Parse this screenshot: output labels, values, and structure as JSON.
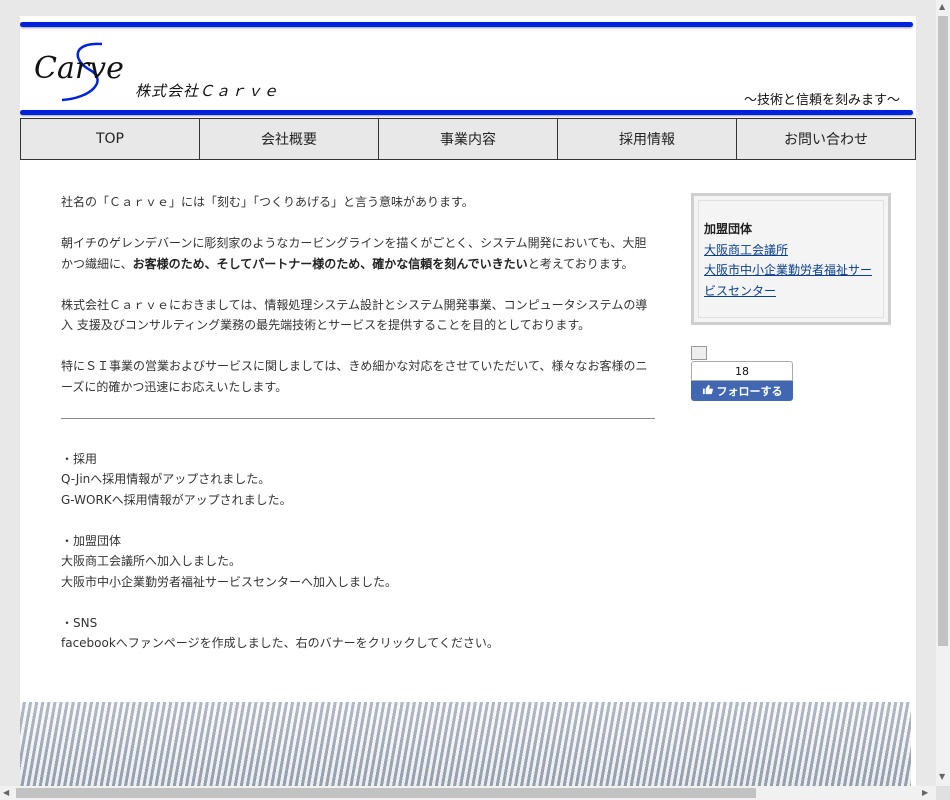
{
  "header": {
    "logo_text": "Carve",
    "company_name": "株式会社Ｃａｒｖｅ",
    "tagline": "～技術と信頼を刻みます～",
    "bar_color": "#0022dd"
  },
  "nav": {
    "items": [
      {
        "label": "TOP"
      },
      {
        "label": "会社概要"
      },
      {
        "label": "事業内容"
      },
      {
        "label": "採用情報"
      },
      {
        "label": "お問い合わせ"
      }
    ]
  },
  "main": {
    "p1": "社名の「Ｃａｒｖｅ」には「刻む」「つくりあげる」と言う意味があります。",
    "p2_a": "朝イチのゲレンデバーンに彫刻家のようなカービングラインを描くがごとく、システム開発においても、大胆かつ繊細に、",
    "p2_bold": "お客様のため、そしてパートナー様のため、確かな信頼を刻んでいきたい",
    "p2_b": "と考えております。",
    "p3": "株式会社Ｃａｒｖｅにおきましては、情報処理システム設計とシステム開発事業、コンピュータシステムの導入 支援及びコンサルティング業務の最先端技術とサービスを提供することを目的としております。",
    "p4": "特にＳＩ事業の営業およびサービスに関しましては、きめ細かな対応をさせていただいて、様々なお客様のニーズに的確かつ迅速にお応えいたします。",
    "news": [
      {
        "heading": "・採用",
        "lines": [
          "Q-Jinへ採用情報がアップされました。",
          "G-WORKへ採用情報がアップされました。"
        ]
      },
      {
        "heading": "・加盟団体",
        "lines": [
          "大阪商工会議所へ加入しました。",
          "大阪市中小企業勤労者福祉サービスセンターへ加入しました。"
        ]
      },
      {
        "heading": "・SNS",
        "lines": [
          "facebookへファンページを作成しました、右のバナーをクリックしてください。"
        ]
      }
    ]
  },
  "sidebar": {
    "heading": "加盟団体",
    "links": [
      "大阪商工会議所",
      "大阪市中小企業勤労者福祉サービスセンター"
    ]
  },
  "facebook": {
    "count": "18",
    "follow_label": "フォローする",
    "color": "#4267b2"
  }
}
